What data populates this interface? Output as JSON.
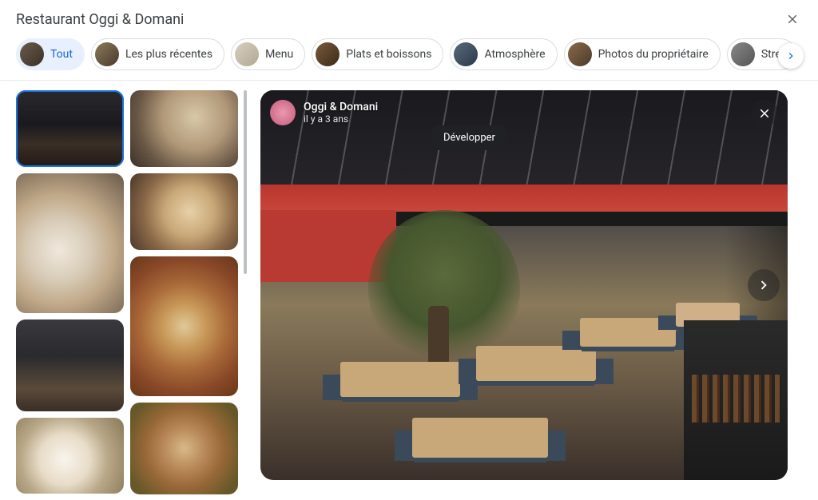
{
  "header": {
    "title": "Restaurant Oggi & Domani"
  },
  "filters": {
    "items": [
      {
        "label": "Tout",
        "active": true
      },
      {
        "label": "Les plus récentes",
        "active": false
      },
      {
        "label": "Menu",
        "active": false
      },
      {
        "label": "Plats et boissons",
        "active": false
      },
      {
        "label": "Atmosphère",
        "active": false
      },
      {
        "label": "Photos du propriétaire",
        "active": false
      },
      {
        "label": "Street",
        "active": false
      }
    ]
  },
  "photo": {
    "uploader_name": "Oggi & Domani",
    "uploader_time": "il y a 3 ans",
    "tooltip": "Développer"
  }
}
